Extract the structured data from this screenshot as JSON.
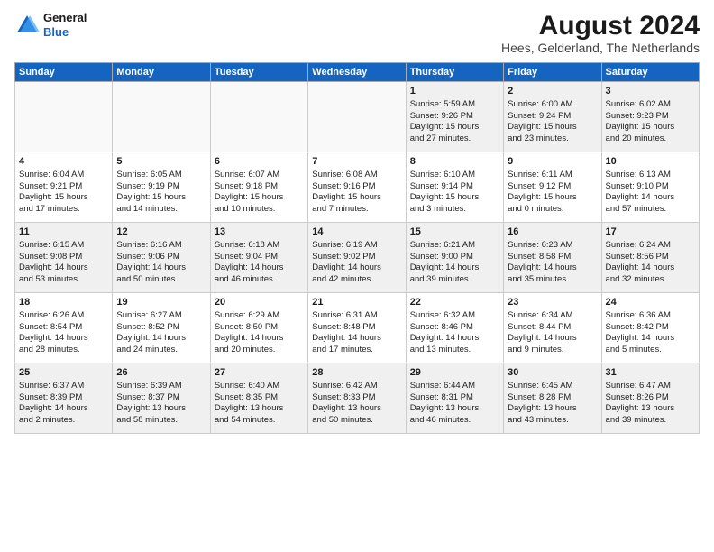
{
  "logo": {
    "line1": "General",
    "line2": "Blue"
  },
  "title": "August 2024",
  "subtitle": "Hees, Gelderland, The Netherlands",
  "days_of_week": [
    "Sunday",
    "Monday",
    "Tuesday",
    "Wednesday",
    "Thursday",
    "Friday",
    "Saturday"
  ],
  "weeks": [
    [
      {
        "day": "",
        "info": ""
      },
      {
        "day": "",
        "info": ""
      },
      {
        "day": "",
        "info": ""
      },
      {
        "day": "",
        "info": ""
      },
      {
        "day": "1",
        "info": "Sunrise: 5:59 AM\nSunset: 9:26 PM\nDaylight: 15 hours\nand 27 minutes."
      },
      {
        "day": "2",
        "info": "Sunrise: 6:00 AM\nSunset: 9:24 PM\nDaylight: 15 hours\nand 23 minutes."
      },
      {
        "day": "3",
        "info": "Sunrise: 6:02 AM\nSunset: 9:23 PM\nDaylight: 15 hours\nand 20 minutes."
      }
    ],
    [
      {
        "day": "4",
        "info": "Sunrise: 6:04 AM\nSunset: 9:21 PM\nDaylight: 15 hours\nand 17 minutes."
      },
      {
        "day": "5",
        "info": "Sunrise: 6:05 AM\nSunset: 9:19 PM\nDaylight: 15 hours\nand 14 minutes."
      },
      {
        "day": "6",
        "info": "Sunrise: 6:07 AM\nSunset: 9:18 PM\nDaylight: 15 hours\nand 10 minutes."
      },
      {
        "day": "7",
        "info": "Sunrise: 6:08 AM\nSunset: 9:16 PM\nDaylight: 15 hours\nand 7 minutes."
      },
      {
        "day": "8",
        "info": "Sunrise: 6:10 AM\nSunset: 9:14 PM\nDaylight: 15 hours\nand 3 minutes."
      },
      {
        "day": "9",
        "info": "Sunrise: 6:11 AM\nSunset: 9:12 PM\nDaylight: 15 hours\nand 0 minutes."
      },
      {
        "day": "10",
        "info": "Sunrise: 6:13 AM\nSunset: 9:10 PM\nDaylight: 14 hours\nand 57 minutes."
      }
    ],
    [
      {
        "day": "11",
        "info": "Sunrise: 6:15 AM\nSunset: 9:08 PM\nDaylight: 14 hours\nand 53 minutes."
      },
      {
        "day": "12",
        "info": "Sunrise: 6:16 AM\nSunset: 9:06 PM\nDaylight: 14 hours\nand 50 minutes."
      },
      {
        "day": "13",
        "info": "Sunrise: 6:18 AM\nSunset: 9:04 PM\nDaylight: 14 hours\nand 46 minutes."
      },
      {
        "day": "14",
        "info": "Sunrise: 6:19 AM\nSunset: 9:02 PM\nDaylight: 14 hours\nand 42 minutes."
      },
      {
        "day": "15",
        "info": "Sunrise: 6:21 AM\nSunset: 9:00 PM\nDaylight: 14 hours\nand 39 minutes."
      },
      {
        "day": "16",
        "info": "Sunrise: 6:23 AM\nSunset: 8:58 PM\nDaylight: 14 hours\nand 35 minutes."
      },
      {
        "day": "17",
        "info": "Sunrise: 6:24 AM\nSunset: 8:56 PM\nDaylight: 14 hours\nand 32 minutes."
      }
    ],
    [
      {
        "day": "18",
        "info": "Sunrise: 6:26 AM\nSunset: 8:54 PM\nDaylight: 14 hours\nand 28 minutes."
      },
      {
        "day": "19",
        "info": "Sunrise: 6:27 AM\nSunset: 8:52 PM\nDaylight: 14 hours\nand 24 minutes."
      },
      {
        "day": "20",
        "info": "Sunrise: 6:29 AM\nSunset: 8:50 PM\nDaylight: 14 hours\nand 20 minutes."
      },
      {
        "day": "21",
        "info": "Sunrise: 6:31 AM\nSunset: 8:48 PM\nDaylight: 14 hours\nand 17 minutes."
      },
      {
        "day": "22",
        "info": "Sunrise: 6:32 AM\nSunset: 8:46 PM\nDaylight: 14 hours\nand 13 minutes."
      },
      {
        "day": "23",
        "info": "Sunrise: 6:34 AM\nSunset: 8:44 PM\nDaylight: 14 hours\nand 9 minutes."
      },
      {
        "day": "24",
        "info": "Sunrise: 6:36 AM\nSunset: 8:42 PM\nDaylight: 14 hours\nand 5 minutes."
      }
    ],
    [
      {
        "day": "25",
        "info": "Sunrise: 6:37 AM\nSunset: 8:39 PM\nDaylight: 14 hours\nand 2 minutes."
      },
      {
        "day": "26",
        "info": "Sunrise: 6:39 AM\nSunset: 8:37 PM\nDaylight: 13 hours\nand 58 minutes."
      },
      {
        "day": "27",
        "info": "Sunrise: 6:40 AM\nSunset: 8:35 PM\nDaylight: 13 hours\nand 54 minutes."
      },
      {
        "day": "28",
        "info": "Sunrise: 6:42 AM\nSunset: 8:33 PM\nDaylight: 13 hours\nand 50 minutes."
      },
      {
        "day": "29",
        "info": "Sunrise: 6:44 AM\nSunset: 8:31 PM\nDaylight: 13 hours\nand 46 minutes."
      },
      {
        "day": "30",
        "info": "Sunrise: 6:45 AM\nSunset: 8:28 PM\nDaylight: 13 hours\nand 43 minutes."
      },
      {
        "day": "31",
        "info": "Sunrise: 6:47 AM\nSunset: 8:26 PM\nDaylight: 13 hours\nand 39 minutes."
      }
    ]
  ]
}
